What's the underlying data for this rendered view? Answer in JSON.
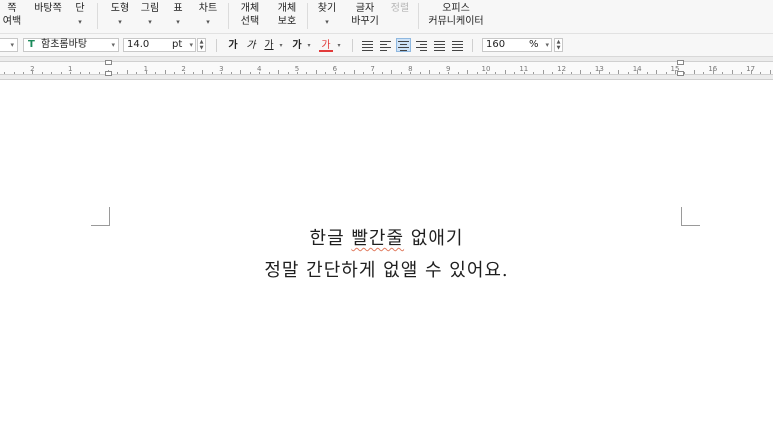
{
  "ribbon": {
    "groups": [
      {
        "id": "margin",
        "top": "쪽",
        "bottom": "여백",
        "dropdown": true
      },
      {
        "id": "background",
        "top": "바탕쪽",
        "bottom": "",
        "dropdown": false
      },
      {
        "id": "column",
        "top": "단",
        "bottom": "",
        "dropdown": true
      },
      {
        "id": "shape",
        "top": "도형",
        "bottom": "",
        "dropdown": true
      },
      {
        "id": "picture",
        "top": "그림",
        "bottom": "",
        "dropdown": true
      },
      {
        "id": "table",
        "top": "표",
        "bottom": "",
        "dropdown": true
      },
      {
        "id": "chart",
        "top": "차트",
        "bottom": "",
        "dropdown": true
      },
      {
        "id": "object-select",
        "top": "개체",
        "bottom": "선택",
        "dropdown": true
      },
      {
        "id": "object-protect",
        "top": "개체",
        "bottom": "보호",
        "dropdown": true
      },
      {
        "id": "find",
        "top": "찾기",
        "bottom": "",
        "dropdown": true
      },
      {
        "id": "replace-text",
        "top": "글자",
        "bottom": "바꾸기",
        "dropdown": true
      },
      {
        "id": "sort",
        "top": "정렬",
        "bottom": "",
        "dropdown": false,
        "disabled": true
      },
      {
        "id": "office-communicator",
        "top": "오피스",
        "bottom": "커뮤니케이터",
        "dropdown": false
      }
    ]
  },
  "format_toolbar": {
    "font_icon": "T",
    "font_name": "함초롬바탕",
    "font_size": "14.0",
    "size_unit": "pt",
    "bold": "가",
    "italic": "가",
    "underline": "가",
    "strikethrough": "가",
    "font_color": "가",
    "font_color_value": "#e23b3b",
    "zoom_value": "160",
    "zoom_unit": "%"
  },
  "ruler": {
    "numbers": [
      "2",
      "1",
      "1",
      "2",
      "3",
      "4",
      "5",
      "6",
      "7",
      "8",
      "9",
      "10",
      "11",
      "12",
      "13",
      "14",
      "15",
      "16",
      "17"
    ]
  },
  "document": {
    "line1_part1": "한글 ",
    "line1_flagged": "빨간줄",
    "line1_part2": " 없애기",
    "line2": "정말 간단하게 없앨 수 있어요."
  }
}
